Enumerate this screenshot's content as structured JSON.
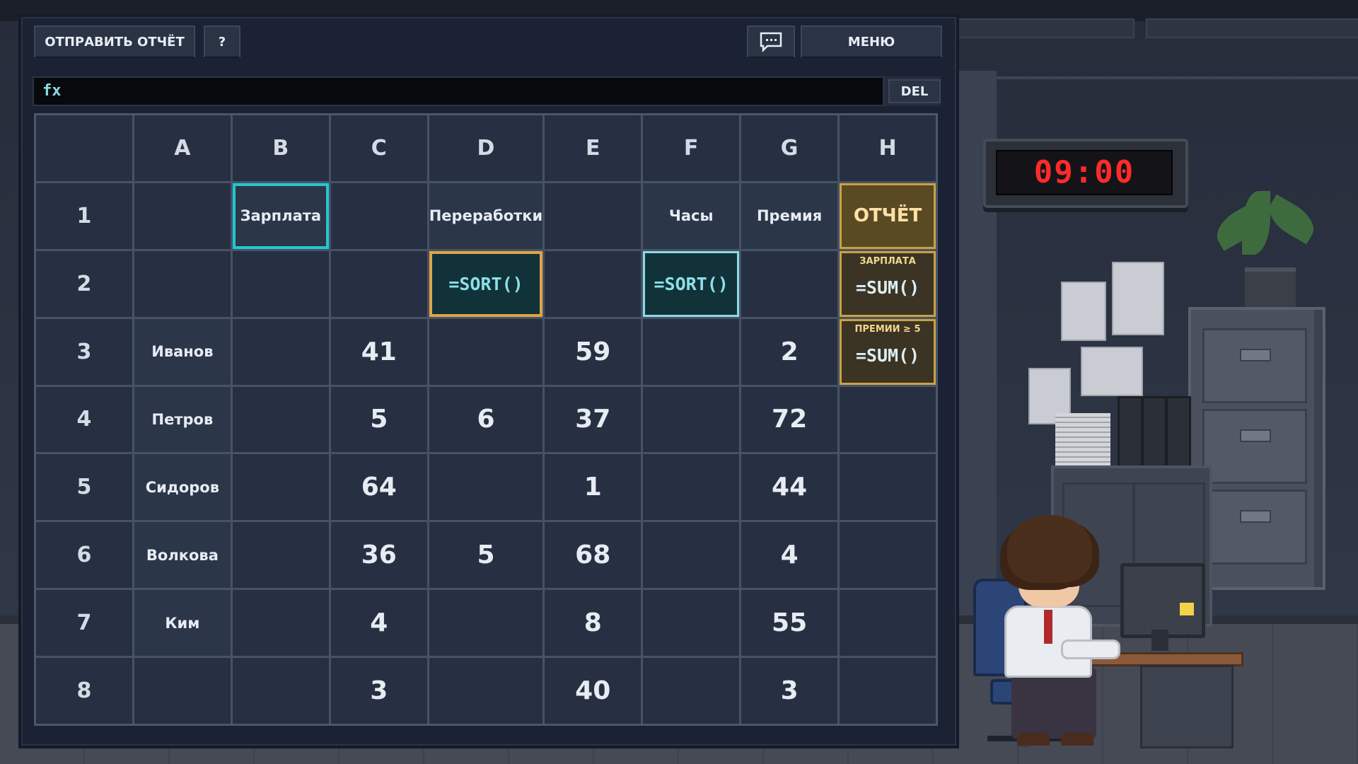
{
  "toolbar": {
    "send_report": "ОТПРАВИТЬ ОТЧЁТ",
    "help": "?",
    "menu": "МЕНЮ",
    "chat_icon": "chat-bubble-icon"
  },
  "formula_bar": {
    "label": "fx",
    "value": "",
    "delete": "DEL"
  },
  "clock": {
    "time": "09:00"
  },
  "sheet": {
    "columns": [
      "A",
      "B",
      "C",
      "D",
      "E",
      "F",
      "G",
      "H"
    ],
    "rows": [
      {
        "num": "1",
        "cells": [
          "",
          "Зарплата",
          "",
          "Переработки",
          "",
          "Часы",
          "Премия",
          "ОТЧЁТ"
        ]
      },
      {
        "num": "2",
        "cells": [
          "",
          "",
          "",
          "=SORT()",
          "",
          "=SORT()",
          "",
          "=SUM()"
        ]
      },
      {
        "num": "3",
        "cells": [
          "Иванов",
          "",
          "41",
          "",
          "59",
          "",
          "2",
          "=SUM()"
        ]
      },
      {
        "num": "4",
        "cells": [
          "Петров",
          "",
          "5",
          "6",
          "37",
          "",
          "72",
          ""
        ]
      },
      {
        "num": "5",
        "cells": [
          "Сидоров",
          "",
          "64",
          "",
          "1",
          "",
          "44",
          ""
        ]
      },
      {
        "num": "6",
        "cells": [
          "Волкова",
          "",
          "36",
          "5",
          "68",
          "",
          "4",
          ""
        ]
      },
      {
        "num": "7",
        "cells": [
          "Ким",
          "",
          "4",
          "",
          "8",
          "",
          "55",
          ""
        ]
      },
      {
        "num": "8",
        "cells": [
          "",
          "",
          "3",
          "",
          "40",
          "",
          "3",
          ""
        ]
      }
    ],
    "report_labels": {
      "H2": "ЗАРПЛАТА",
      "H3": "ПРЕМИИ ≥ 5"
    }
  },
  "colors": {
    "selection": "#22c7cf",
    "formula_highlight": "#e0a544",
    "report_gold": "#caa142",
    "clock_digits": "#ff2b2b"
  }
}
